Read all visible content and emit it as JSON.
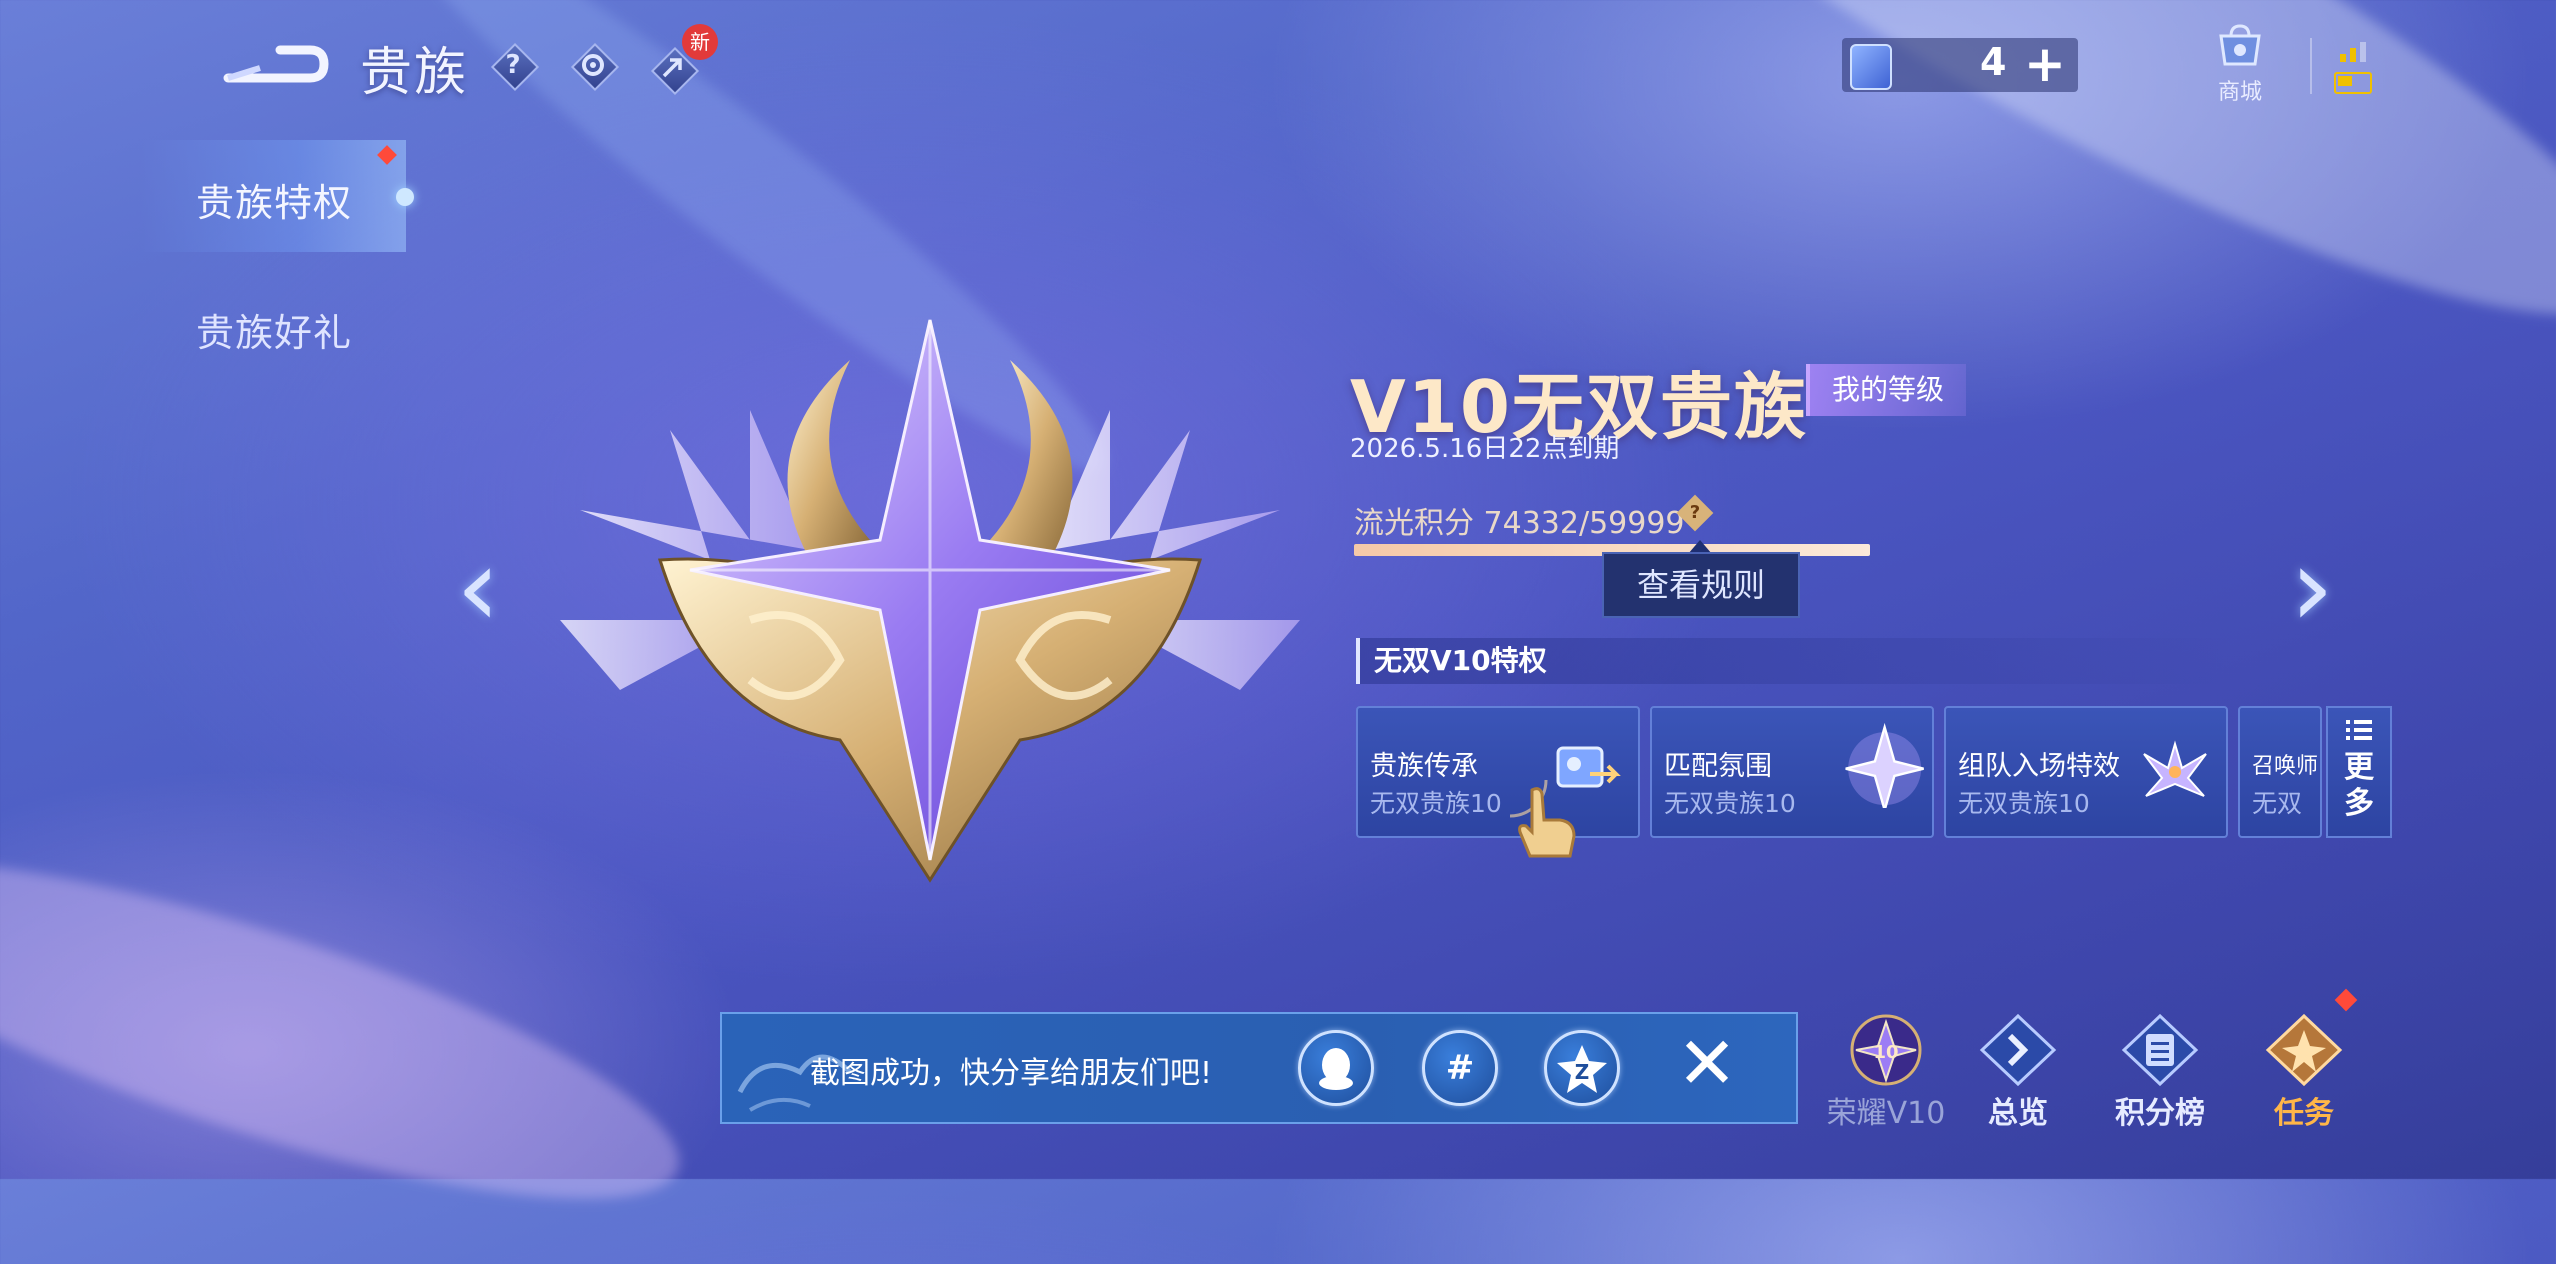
{
  "header": {
    "title": "贵族",
    "help_icon": "?",
    "new_badge": "新",
    "ticket_count": "4",
    "ticket_add": "+",
    "shop_label": "商城"
  },
  "sidebar": {
    "items": [
      {
        "label": "贵族特权"
      },
      {
        "label": "贵族好礼"
      }
    ]
  },
  "rank": {
    "title": "V10无双贵族",
    "my_level_tag": "我的等级",
    "expire": "2026.5.16日22点到期",
    "points_label": "流光积分 74332/59999",
    "points_current": 74332,
    "points_total": 59999,
    "progress": 1.0,
    "rule_button": "查看规则"
  },
  "privileges": {
    "section_title": "无双V10特权",
    "cards": [
      {
        "title": "贵族传承",
        "sub": "无双贵族10"
      },
      {
        "title": "匹配氛围",
        "sub": "无双贵族10"
      },
      {
        "title": "组队入场特效",
        "sub": "无双贵族10"
      },
      {
        "title": "召唤师",
        "sub": "无双"
      }
    ],
    "more_line1": "更",
    "more_line2": "多"
  },
  "bottom_nav": {
    "honor_label": "荣耀V10",
    "overview_label": "总览",
    "ranking_label": "积分榜",
    "task_label": "任务",
    "partial_label": "0"
  },
  "toast": {
    "message": "截图成功，快分享给朋友们吧!",
    "close": "✕"
  },
  "colors": {
    "accent_gold": "#fde8c8",
    "toast_bg": "#2a63b8",
    "card_bg": "#3b55b8",
    "badge_red": "#e23a3a"
  }
}
